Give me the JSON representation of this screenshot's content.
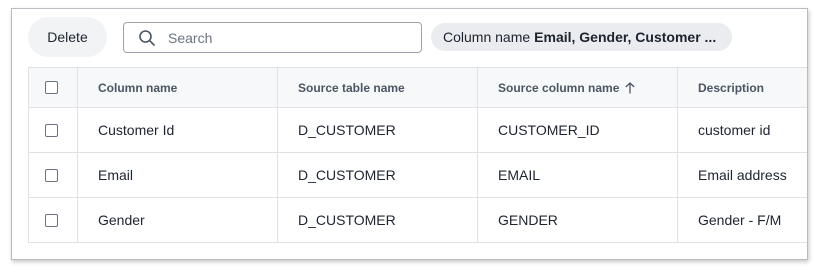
{
  "toolbar": {
    "delete_label": "Delete",
    "search_placeholder": "Search",
    "filter_chip": {
      "prefix": "Column name",
      "value": "Email, Gender, Customer ..."
    }
  },
  "table": {
    "columns": [
      "Column name",
      "Source table name",
      "Source column name",
      "Description"
    ],
    "sorted_column_index": 2,
    "sort_direction": "ascending",
    "rows": [
      [
        "Customer Id",
        "D_CUSTOMER",
        "CUSTOMER_ID",
        "customer id"
      ],
      [
        "Email",
        "D_CUSTOMER",
        "EMAIL",
        "Email address"
      ],
      [
        "Gender",
        "D_CUSTOMER",
        "GENDER",
        "Gender - F/M"
      ]
    ]
  },
  "icons": {
    "search": "search-icon",
    "sort": "sort-ascending-icon"
  }
}
